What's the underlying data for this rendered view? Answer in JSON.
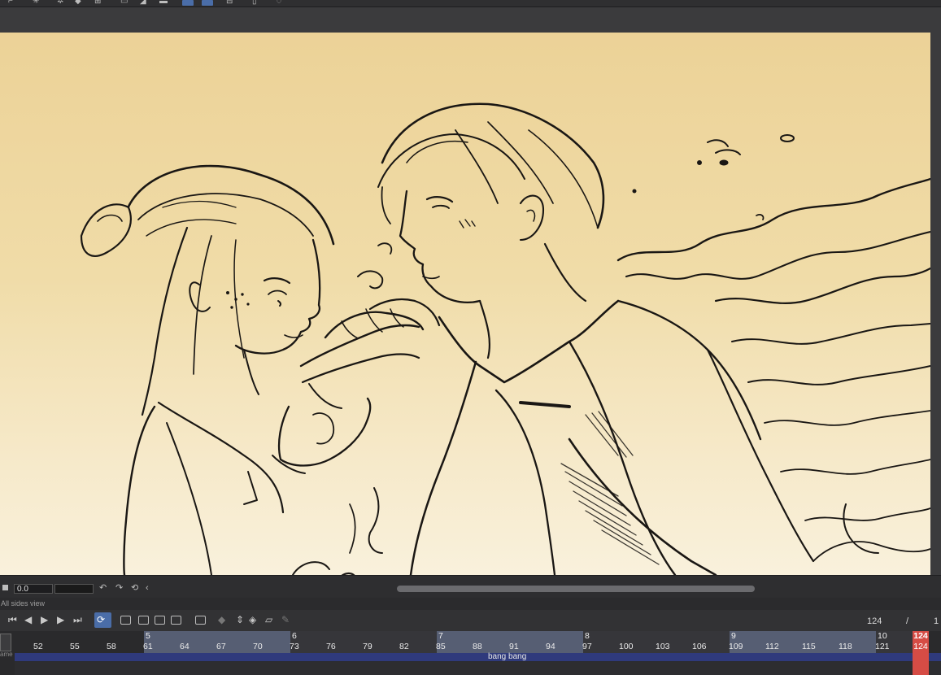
{
  "toolbar": {
    "icons": [
      "paint-icon",
      "star-icon",
      "diamond-icon",
      "grid-icon",
      "rect-icon",
      "fill-icon",
      "undo-icon",
      "redo-icon",
      "select-icon",
      "zoom-icon",
      "phone-icon",
      "speech-icon"
    ]
  },
  "canvas": {
    "accent_top": "#ecd297",
    "accent_bottom": "#f9f1dc"
  },
  "canvas_bar": {
    "angle_value": "0.0"
  },
  "timeline": {
    "panel_title": "All sides view",
    "current_frame": "124",
    "separator": "/",
    "total_frame": "1",
    "sections": [
      {
        "label": "5",
        "start": "61"
      },
      {
        "label": "6",
        "start": "73"
      },
      {
        "label": "7",
        "start": "85"
      },
      {
        "label": "8",
        "start": "97"
      },
      {
        "label": "9",
        "start": "109"
      },
      {
        "label": "10",
        "start": "121"
      }
    ],
    "ticks": [
      "52",
      "55",
      "58",
      "61",
      "64",
      "67",
      "70",
      "73",
      "76",
      "79",
      "82",
      "85",
      "88",
      "91",
      "94",
      "97",
      "100",
      "103",
      "106",
      "109",
      "112",
      "115",
      "118",
      "121"
    ],
    "playhead_label": "124",
    "playhead_tick": "124",
    "track_name": "bang bang",
    "track_left_label": "ame",
    "loop_color": "#4a6da8",
    "playhead_color": "#d64c45"
  }
}
